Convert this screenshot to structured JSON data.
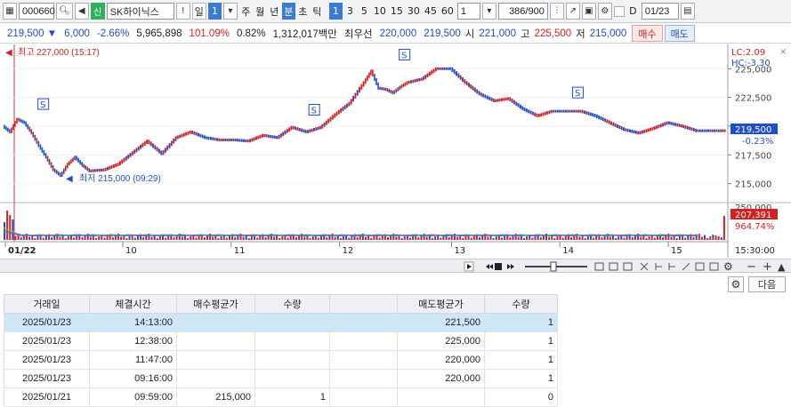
{
  "toolbar": {
    "code": "000660",
    "market_badge": "신",
    "name": "SK하이닉스",
    "alert": "!",
    "day": "일",
    "day_num": "1",
    "periods": [
      "주",
      "월",
      "년",
      "분",
      "초",
      "틱"
    ],
    "selected_period": "분",
    "intervals": [
      "1",
      "3",
      "5",
      "10",
      "15",
      "30",
      "45",
      "60"
    ],
    "selected_interval": "1",
    "count_value": "1",
    "ratio": "386/900",
    "d_label": "D",
    "date": "01/23"
  },
  "quote": {
    "price": "219,500 ▼",
    "change": "6,000",
    "change_pct": "-2.66%",
    "volume": "5,965,898",
    "vol_ratio": "101.09%",
    "turnover": "0.82%",
    "amount": "1,312,017백만",
    "bid_label": "최우선",
    "bid_sell": "220,000",
    "bid_buy": "219,500",
    "open_label": "시",
    "open": "221,000",
    "high_label": "고",
    "high": "225,500",
    "low_label": "저",
    "low": "215,000",
    "buy_button": "매수",
    "sell_button": "매도"
  },
  "chart": {
    "lc_label": "LC:2.09",
    "hc_label": "HC:-3.30",
    "y_ticks": [
      "225,000",
      "222,500",
      "220,000",
      "217,500",
      "215,000"
    ],
    "current_price": "219,500",
    "current_pct": "-0.23%",
    "vol_ticks": [
      "250,000",
      "207,391",
      "964.74%"
    ],
    "max_label": "최고 227,000 (15:17)",
    "min_label": "최저 215,000 (09:29)",
    "signal": "S",
    "time_label": "15:30:00",
    "x_labels": [
      "01/22",
      "10",
      "11",
      "12",
      "13",
      "14",
      "15"
    ]
  },
  "chart_data": {
    "type": "line",
    "title": "",
    "y_range": [
      213500,
      226800
    ],
    "series": [
      {
        "name": "",
        "x": [
          0,
          0.01,
          0.02,
          0.03,
          0.04,
          0.05,
          0.06,
          0.07,
          0.08,
          0.09,
          0.1,
          0.11,
          0.12,
          0.14,
          0.16,
          0.18,
          0.2,
          0.22,
          0.24,
          0.26,
          0.28,
          0.3,
          0.32,
          0.34,
          0.36,
          0.38,
          0.4,
          0.42,
          0.44,
          0.46,
          0.48,
          0.5,
          0.51,
          0.52,
          0.53,
          0.54,
          0.55,
          0.56,
          0.58,
          0.6,
          0.62,
          0.64,
          0.66,
          0.68,
          0.7,
          0.72,
          0.74,
          0.76,
          0.78,
          0.8,
          0.82,
          0.84,
          0.86,
          0.88,
          0.9,
          0.92,
          0.94,
          0.96,
          0.98,
          1.0
        ],
        "y": [
          220000,
          219500,
          220600,
          220300,
          219400,
          218300,
          217300,
          216200,
          215700,
          216700,
          217300,
          216600,
          216100,
          216200,
          216700,
          217700,
          218700,
          217600,
          219000,
          219500,
          219000,
          218800,
          218800,
          218700,
          219200,
          219000,
          219900,
          219500,
          219900,
          221000,
          222000,
          223800,
          224800,
          223300,
          223200,
          222900,
          223400,
          223800,
          224100,
          225000,
          225000,
          223800,
          222800,
          222200,
          222400,
          221500,
          220900,
          221300,
          221300,
          221300,
          220900,
          220300,
          219700,
          219400,
          219800,
          220300,
          220000,
          219600,
          219600,
          219600
        ]
      }
    ]
  },
  "bottom": {
    "settings_label": "⚙",
    "next_button": "다음",
    "headers": [
      "거래일",
      "체결시간",
      "매수평균가",
      "수량",
      "",
      "매도평균가",
      "수량"
    ],
    "rows": [
      [
        "2025/01/23",
        "14:13:00",
        "",
        "",
        "",
        "221,500",
        "1"
      ],
      [
        "2025/01/23",
        "12:38:00",
        "",
        "",
        "",
        "225,000",
        "1"
      ],
      [
        "2025/01/23",
        "11:47:00",
        "",
        "",
        "",
        "220,000",
        "1"
      ],
      [
        "2025/01/23",
        "09:16:00",
        "",
        "",
        "",
        "220,000",
        "1"
      ],
      [
        "2025/01/21",
        "09:59:00",
        "215,000",
        "1",
        "",
        "",
        "0"
      ]
    ]
  }
}
